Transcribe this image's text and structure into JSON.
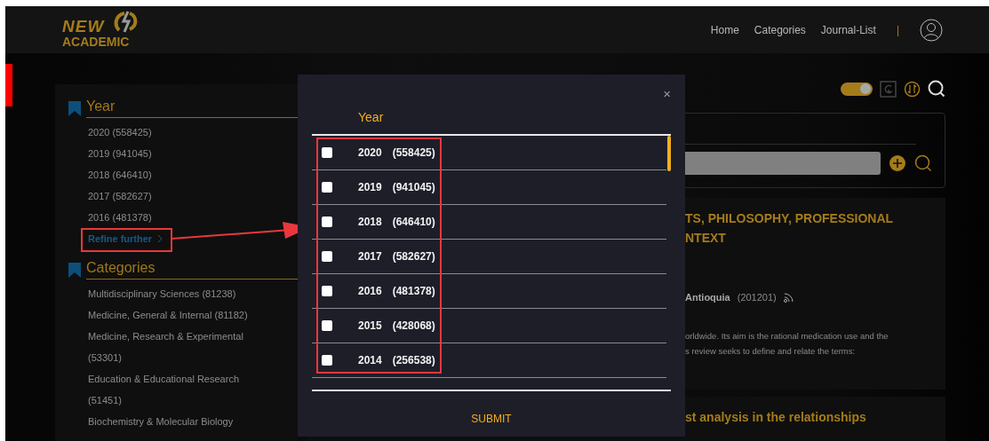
{
  "header": {
    "logo": {
      "top": "NEW",
      "bottom": "ACADEMIC"
    },
    "nav": [
      "Home",
      "Categories",
      "Journal-List"
    ],
    "separator": "|"
  },
  "sidebar": {
    "sections": [
      {
        "title": "Year",
        "items": [
          "2020 (558425)",
          "2019 (941045)",
          "2018 (646410)",
          "2017 (582627)",
          "2016 (481378)"
        ],
        "link": "Refine further"
      },
      {
        "title": "Categories",
        "items": [
          "Multidisciplinary Sciences (81238)",
          "Medicine, General & Internal (81182)",
          "Medicine, Research & Experimental (53301)",
          "Education & Educational Research (51451)",
          "Biochemistry & Molecular Biology"
        ]
      }
    ]
  },
  "toolbar": {
    "toggle": {
      "on": true
    }
  },
  "results": [
    {
      "title_lines": [
        "TS, PHILOSOPHY, PROFESSIONAL",
        "NTEXT"
      ],
      "source": "Antioquia",
      "code": "(201201)",
      "abstract_lines": [
        "orldwide. Its aim is the rational medication use and the",
        "s review seeks to define and relate the terms:"
      ]
    },
    {
      "title_lines": [
        "st analysis in the relationships"
      ]
    }
  ],
  "modal": {
    "close": "×",
    "title": "Year",
    "options": [
      {
        "year": "2020",
        "count": "(558425)",
        "checked": false
      },
      {
        "year": "2019",
        "count": "(941045)",
        "checked": false
      },
      {
        "year": "2018",
        "count": "(646410)",
        "checked": false
      },
      {
        "year": "2017",
        "count": "(582627)",
        "checked": false
      },
      {
        "year": "2016",
        "count": "(481378)",
        "checked": false
      },
      {
        "year": "2015",
        "count": "(428068)",
        "checked": false
      },
      {
        "year": "2014",
        "count": "(256538)",
        "checked": false
      }
    ],
    "submit": "SUBMIT"
  }
}
